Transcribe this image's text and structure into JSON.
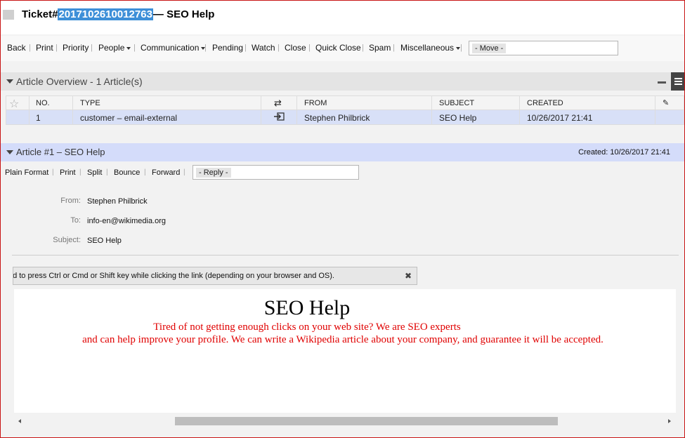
{
  "ticket": {
    "label": "Ticket#",
    "number": "2017102610012763",
    "title_suffix": "— SEO Help"
  },
  "toolbar": {
    "items": [
      "Back",
      "Print",
      "Priority",
      "People",
      "Communication",
      "Pending",
      "Watch",
      "Close",
      "Quick Close",
      "Spam",
      "Miscellaneous"
    ],
    "move_select": "- Move -"
  },
  "overview": {
    "title": "Article Overview - 1 Article(s)",
    "columns": {
      "no": "NO.",
      "type": "TYPE",
      "direction_icon": "swap-arrows-icon",
      "from": "FROM",
      "subject": "SUBJECT",
      "created": "CREATED",
      "attachment_icon": "paperclip-icon"
    },
    "rows": [
      {
        "no": "1",
        "type": "customer – email-external",
        "direction_icon": "incoming-arrow-icon",
        "from": "Stephen Philbrick",
        "subject": "SEO Help",
        "created": "10/26/2017 21:41"
      }
    ]
  },
  "article": {
    "title": "Article #1 – SEO Help",
    "created_label": "Created:",
    "created_value": "10/26/2017 21:41",
    "actions": [
      "Plain Format",
      "Print",
      "Split",
      "Bounce",
      "Forward"
    ],
    "reply_select": "- Reply -",
    "from_label": "From:",
    "from_value": "Stephen Philbrick",
    "to_label": "To:",
    "to_value": "info-en@wikimedia.org",
    "subject_label": "Subject:",
    "subject_value": "SEO Help",
    "notice": "d to press Ctrl or Cmd or Shift key while clicking the link (depending on your browser and OS).",
    "body": {
      "heading": "SEO Help",
      "line1": "Tired of not getting enough clicks on your web site? We are SEO experts",
      "line2": "and can help improve your profile. We can write a Wikipedia article about your company, and guarantee it will be accepted."
    }
  },
  "colors": {
    "highlight": "#3d8fd8",
    "selected_row": "#d8e0f7",
    "article_header": "#d4dcfa",
    "email_text": "#e00000",
    "frame_border": "#c81414"
  }
}
